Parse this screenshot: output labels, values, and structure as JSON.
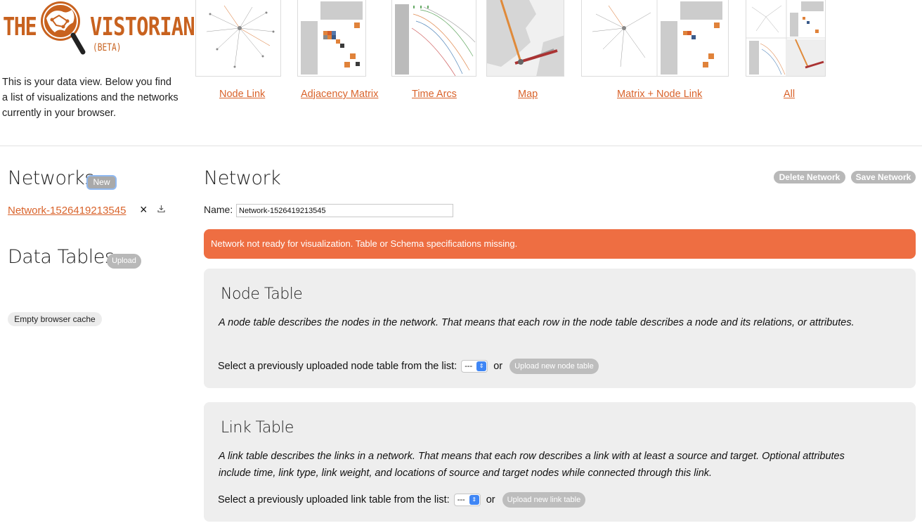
{
  "app": {
    "logo": {
      "the": "THE",
      "vistorian": "VISTORIAN",
      "beta": "(BETA)"
    },
    "intro": "This is your data view. Below you find a list of visualizations and the networks currently in your browser."
  },
  "visualizations": [
    {
      "label": "Node Link",
      "icon": "node-link-thumbnail"
    },
    {
      "label": "Adjacency Matrix",
      "icon": "adjacency-matrix-thumbnail"
    },
    {
      "label": "Time Arcs",
      "icon": "time-arcs-thumbnail"
    },
    {
      "label": "Map",
      "icon": "map-thumbnail"
    },
    {
      "label": "Matrix + Node Link",
      "icon": "matrix-node-link-thumbnail"
    },
    {
      "label": "All",
      "icon": "all-views-thumbnail"
    }
  ],
  "sidebar": {
    "networks_heading": "Networks",
    "new_button": "New",
    "network_items": [
      {
        "name": "Network-1526419213545"
      }
    ],
    "delete_icon": "×",
    "data_tables_heading": "Data Tables",
    "upload_button": "Upload",
    "empty_cache_button": "Empty browser cache"
  },
  "main": {
    "heading": "Network",
    "delete_network": "Delete Network",
    "save_network": "Save Network",
    "name_label": "Name:",
    "name_value": "Network-1526419213545",
    "alert": "Network not ready for visualization. Table or Schema specifications missing.",
    "node_table": {
      "title": "Node Table",
      "description": "A node table describes the nodes in the network. That means that each row in the node table describes a node and its relations, or attributes.",
      "select_prompt": "Select a previously uploaded node table from the list:",
      "select_value": "---",
      "or": "or",
      "upload_button": "Upload new node table"
    },
    "link_table": {
      "title": "Link Table",
      "description": "A link table describes the links in a network. That means that each row describes a link with at least a source and target. Optional attributes include time, link type, link weight, and locations of source and target nodes while connected through this link.",
      "select_prompt": "Select a previously uploaded link table from the list:",
      "select_value": "---",
      "or": "or",
      "upload_button": "Upload new link table"
    }
  },
  "colors": {
    "accent": "#d9632b",
    "alert": "#ee6e42",
    "panel": "#eeeeee",
    "pill": "#b8b8b8"
  }
}
